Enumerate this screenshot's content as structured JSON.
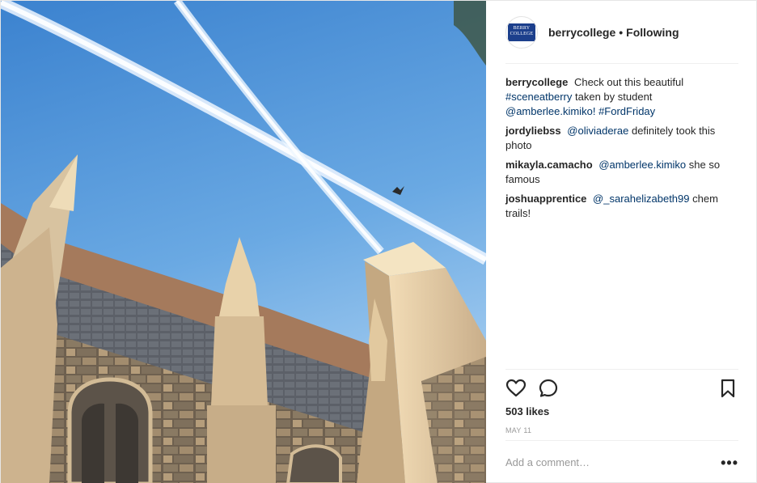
{
  "header": {
    "username": "berrycollege",
    "separator": "•",
    "follow_status": "Following",
    "avatar_logo_text": "BERRY COLLEGE"
  },
  "caption": {
    "username": "berrycollege",
    "text_1": "Check out this beautiful",
    "hashtag_1": "#sceneatberry",
    "text_2": "taken by student",
    "mention": "@amberlee.kimiko!",
    "hashtag_2": "#FordFriday"
  },
  "comments": [
    {
      "username": "jordyliebss",
      "mention": "@oliviaderae",
      "text": "definitely took this photo"
    },
    {
      "username": "mikayla.camacho",
      "mention": "@amberlee.kimiko",
      "text": "she so famous"
    },
    {
      "username": "joshuapprentice",
      "mention": "@_sarahelizabeth99",
      "text": "chem trails!"
    }
  ],
  "actions": {
    "like_icon": "heart-icon",
    "comment_icon": "comment-bubble-icon",
    "save_icon": "bookmark-icon"
  },
  "likes": "503 likes",
  "date": "MAY 11",
  "add_comment": {
    "placeholder": "Add a comment…",
    "more_label": "•••"
  },
  "colors": {
    "sky_top": "#3d85d0",
    "sky_bottom": "#8cc0ec",
    "stone": "#c9ae8a",
    "roof": "#6b7078",
    "link": "#003569",
    "muted": "#999999",
    "logo": "#1c3f8c"
  }
}
